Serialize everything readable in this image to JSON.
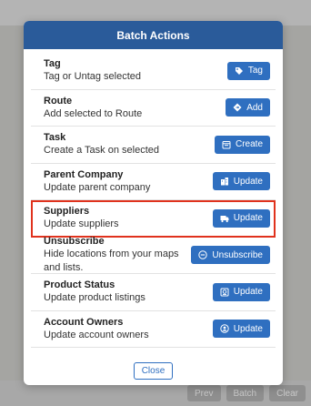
{
  "modal": {
    "title": "Batch Actions",
    "close_label": "Close"
  },
  "actions": [
    {
      "title": "Tag",
      "desc": "Tag or Untag selected",
      "button": "Tag",
      "icon": "tag-icon"
    },
    {
      "title": "Route",
      "desc": "Add selected to Route",
      "button": "Add",
      "icon": "route-diamond-icon"
    },
    {
      "title": "Task",
      "desc": "Create a Task on selected",
      "button": "Create",
      "icon": "calendar-icon"
    },
    {
      "title": "Parent Company",
      "desc": "Update parent company",
      "button": "Update",
      "icon": "building-icon"
    },
    {
      "title": "Suppliers",
      "desc": "Update suppliers",
      "button": "Update",
      "icon": "truck-icon"
    },
    {
      "title": "Unsubscribe",
      "desc": "Hide locations from your maps and lists.",
      "button": "Unsubscribe",
      "icon": "minus-circle-icon"
    },
    {
      "title": "Product Status",
      "desc": "Update product listings",
      "button": "Update",
      "icon": "product-box-icon"
    },
    {
      "title": "Account Owners",
      "desc": "Update account owners",
      "button": "Update",
      "icon": "user-circle-icon"
    }
  ],
  "background": {
    "buttons": [
      "Prev",
      "Batch",
      "Clear"
    ]
  },
  "colors": {
    "header": "#2a5b9a",
    "button": "#2f6fc0",
    "highlight": "#e0321d"
  }
}
